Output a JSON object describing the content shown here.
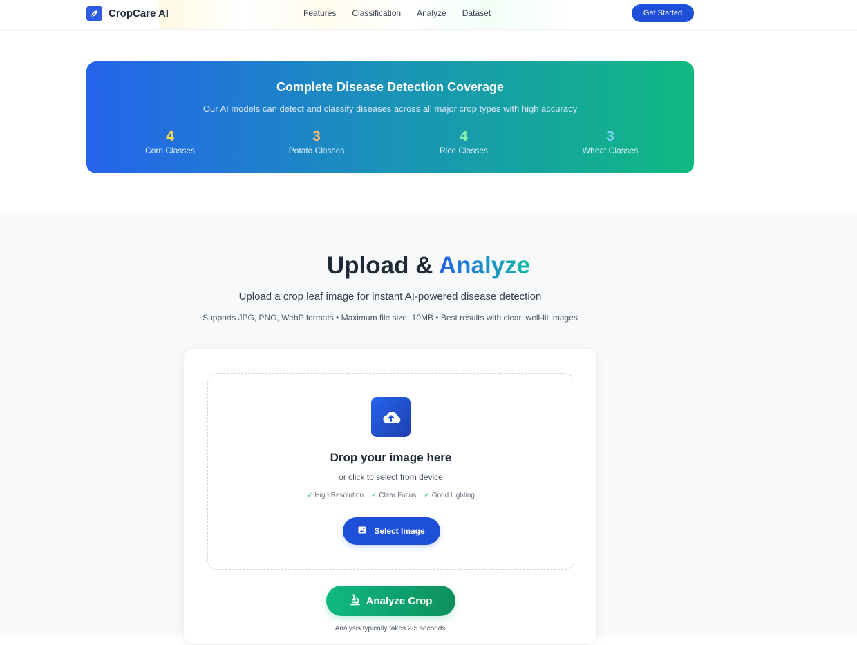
{
  "brand": {
    "name": "CropCare AI",
    "icon": "leaf-icon"
  },
  "nav": {
    "links": [
      "Features",
      "Classification",
      "Analyze",
      "Dataset"
    ],
    "cta_label": "Get Started"
  },
  "coverage": {
    "title": "Complete Disease Detection Coverage",
    "subtitle": "Our AI models can detect and classify diseases across all major crop types with high accuracy",
    "stats": [
      {
        "value": "4",
        "label": "Corn Classes",
        "color": "#fde047"
      },
      {
        "value": "3",
        "label": "Potato Classes",
        "color": "#fdba74"
      },
      {
        "value": "4",
        "label": "Rice Classes",
        "color": "#86efac"
      },
      {
        "value": "3",
        "label": "Wheat Classes",
        "color": "#7dd3fc"
      }
    ]
  },
  "upload": {
    "title_main": "Upload & ",
    "title_accent": "Analyze",
    "subtitle": "Upload a crop leaf image for instant AI-powered disease detection",
    "note": "Supports JPG, PNG, WebP formats • Maximum file size: 10MB • Best results with clear, well-lit images",
    "dropzone": {
      "icon": "cloud-upload-icon",
      "title": "Drop your image here",
      "subtitle": "or click to select from device",
      "tips": [
        "High Resolution",
        "Clear Focus",
        "Good Lighting"
      ],
      "select_label": "Select Image"
    },
    "analyze_label": "Analyze Crop",
    "analysis_note": "Analysis typically takes 2-5 seconds"
  },
  "colors": {
    "primary": "#1e4fd8",
    "success": "#10b981",
    "banner_start": "#2563eb",
    "banner_end": "#10b981"
  }
}
